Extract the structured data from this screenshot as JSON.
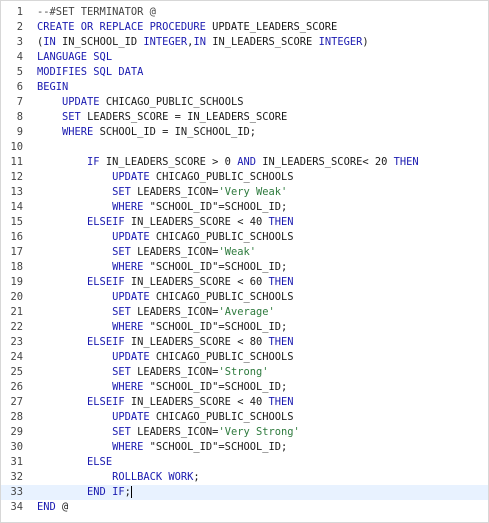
{
  "colors": {
    "keyword": "#1a1ab0",
    "string": "#2d7a3d",
    "text": "#1a1a1a",
    "line_number": "#444444",
    "active_line": "#e8f2ff"
  },
  "editor": {
    "active_line": 33,
    "lines": [
      {
        "num": "1",
        "tokens": [
          {
            "t": "comment",
            "v": "--#SET TERMINATOR @"
          }
        ]
      },
      {
        "num": "2",
        "tokens": [
          {
            "t": "keyword",
            "v": "CREATE OR REPLACE PROCEDURE"
          },
          {
            "t": "text",
            "v": " UPDATE_LEADERS_SCORE"
          }
        ]
      },
      {
        "num": "3",
        "tokens": [
          {
            "t": "punct",
            "v": "("
          },
          {
            "t": "keyword",
            "v": "IN"
          },
          {
            "t": "text",
            "v": " IN_SCHOOL_ID "
          },
          {
            "t": "type",
            "v": "INTEGER"
          },
          {
            "t": "punct",
            "v": ","
          },
          {
            "t": "keyword",
            "v": "IN"
          },
          {
            "t": "text",
            "v": " IN_LEADERS_SCORE "
          },
          {
            "t": "type",
            "v": "INTEGER"
          },
          {
            "t": "punct",
            "v": ")"
          }
        ]
      },
      {
        "num": "4",
        "tokens": [
          {
            "t": "keyword",
            "v": "LANGUAGE SQL"
          }
        ]
      },
      {
        "num": "5",
        "tokens": [
          {
            "t": "keyword",
            "v": "MODIFIES SQL DATA"
          }
        ]
      },
      {
        "num": "6",
        "tokens": [
          {
            "t": "keyword",
            "v": "BEGIN"
          }
        ]
      },
      {
        "num": "7",
        "tokens": [
          {
            "t": "text",
            "v": "    "
          },
          {
            "t": "keyword",
            "v": "UPDATE"
          },
          {
            "t": "text",
            "v": " CHICAGO_PUBLIC_SCHOOLS"
          }
        ]
      },
      {
        "num": "8",
        "tokens": [
          {
            "t": "text",
            "v": "    "
          },
          {
            "t": "keyword",
            "v": "SET"
          },
          {
            "t": "text",
            "v": " LEADERS_SCORE = IN_LEADERS_SCORE"
          }
        ]
      },
      {
        "num": "9",
        "tokens": [
          {
            "t": "text",
            "v": "    "
          },
          {
            "t": "keyword",
            "v": "WHERE"
          },
          {
            "t": "text",
            "v": " SCHOOL_ID = IN_SCHOOL_ID;"
          }
        ]
      },
      {
        "num": "10",
        "tokens": []
      },
      {
        "num": "11",
        "tokens": [
          {
            "t": "text",
            "v": "        "
          },
          {
            "t": "keyword",
            "v": "IF"
          },
          {
            "t": "text",
            "v": " IN_LEADERS_SCORE > 0 "
          },
          {
            "t": "keyword",
            "v": "AND"
          },
          {
            "t": "text",
            "v": " IN_LEADERS_SCORE< 20 "
          },
          {
            "t": "keyword",
            "v": "THEN"
          }
        ]
      },
      {
        "num": "12",
        "tokens": [
          {
            "t": "text",
            "v": "            "
          },
          {
            "t": "keyword",
            "v": "UPDATE"
          },
          {
            "t": "text",
            "v": " CHICAGO_PUBLIC_SCHOOLS"
          }
        ]
      },
      {
        "num": "13",
        "tokens": [
          {
            "t": "text",
            "v": "            "
          },
          {
            "t": "keyword",
            "v": "SET"
          },
          {
            "t": "text",
            "v": " LEADERS_ICON="
          },
          {
            "t": "string",
            "v": "'Very Weak'"
          }
        ]
      },
      {
        "num": "14",
        "tokens": [
          {
            "t": "text",
            "v": "            "
          },
          {
            "t": "keyword",
            "v": "WHERE"
          },
          {
            "t": "text",
            "v": " \"SCHOOL_ID\"=SCHOOL_ID;"
          }
        ]
      },
      {
        "num": "15",
        "tokens": [
          {
            "t": "text",
            "v": "        "
          },
          {
            "t": "keyword",
            "v": "ELSEIF"
          },
          {
            "t": "text",
            "v": " IN_LEADERS_SCORE < 40 "
          },
          {
            "t": "keyword",
            "v": "THEN"
          }
        ]
      },
      {
        "num": "16",
        "tokens": [
          {
            "t": "text",
            "v": "            "
          },
          {
            "t": "keyword",
            "v": "UPDATE"
          },
          {
            "t": "text",
            "v": " CHICAGO_PUBLIC_SCHOOLS"
          }
        ]
      },
      {
        "num": "17",
        "tokens": [
          {
            "t": "text",
            "v": "            "
          },
          {
            "t": "keyword",
            "v": "SET"
          },
          {
            "t": "text",
            "v": " LEADERS_ICON="
          },
          {
            "t": "string",
            "v": "'Weak'"
          }
        ]
      },
      {
        "num": "18",
        "tokens": [
          {
            "t": "text",
            "v": "            "
          },
          {
            "t": "keyword",
            "v": "WHERE"
          },
          {
            "t": "text",
            "v": " \"SCHOOL_ID\"=SCHOOL_ID;"
          }
        ]
      },
      {
        "num": "19",
        "tokens": [
          {
            "t": "text",
            "v": "        "
          },
          {
            "t": "keyword",
            "v": "ELSEIF"
          },
          {
            "t": "text",
            "v": " IN_LEADERS_SCORE < 60 "
          },
          {
            "t": "keyword",
            "v": "THEN"
          }
        ]
      },
      {
        "num": "20",
        "tokens": [
          {
            "t": "text",
            "v": "            "
          },
          {
            "t": "keyword",
            "v": "UPDATE"
          },
          {
            "t": "text",
            "v": " CHICAGO_PUBLIC_SCHOOLS"
          }
        ]
      },
      {
        "num": "21",
        "tokens": [
          {
            "t": "text",
            "v": "            "
          },
          {
            "t": "keyword",
            "v": "SET"
          },
          {
            "t": "text",
            "v": " LEADERS_ICON="
          },
          {
            "t": "string",
            "v": "'Average'"
          }
        ]
      },
      {
        "num": "22",
        "tokens": [
          {
            "t": "text",
            "v": "            "
          },
          {
            "t": "keyword",
            "v": "WHERE"
          },
          {
            "t": "text",
            "v": " \"SCHOOL_ID\"=SCHOOL_ID;"
          }
        ]
      },
      {
        "num": "23",
        "tokens": [
          {
            "t": "text",
            "v": "        "
          },
          {
            "t": "keyword",
            "v": "ELSEIF"
          },
          {
            "t": "text",
            "v": " IN_LEADERS_SCORE < 80 "
          },
          {
            "t": "keyword",
            "v": "THEN"
          }
        ]
      },
      {
        "num": "24",
        "tokens": [
          {
            "t": "text",
            "v": "            "
          },
          {
            "t": "keyword",
            "v": "UPDATE"
          },
          {
            "t": "text",
            "v": " CHICAGO_PUBLIC_SCHOOLS"
          }
        ]
      },
      {
        "num": "25",
        "tokens": [
          {
            "t": "text",
            "v": "            "
          },
          {
            "t": "keyword",
            "v": "SET"
          },
          {
            "t": "text",
            "v": " LEADERS_ICON="
          },
          {
            "t": "string",
            "v": "'Strong'"
          }
        ]
      },
      {
        "num": "26",
        "tokens": [
          {
            "t": "text",
            "v": "            "
          },
          {
            "t": "keyword",
            "v": "WHERE"
          },
          {
            "t": "text",
            "v": " \"SCHOOL_ID\"=SCHOOL_ID;"
          }
        ]
      },
      {
        "num": "27",
        "tokens": [
          {
            "t": "text",
            "v": "        "
          },
          {
            "t": "keyword",
            "v": "ELSEIF"
          },
          {
            "t": "text",
            "v": " IN_LEADERS_SCORE < 40 "
          },
          {
            "t": "keyword",
            "v": "THEN"
          }
        ]
      },
      {
        "num": "28",
        "tokens": [
          {
            "t": "text",
            "v": "            "
          },
          {
            "t": "keyword",
            "v": "UPDATE"
          },
          {
            "t": "text",
            "v": " CHICAGO_PUBLIC_SCHOOLS"
          }
        ]
      },
      {
        "num": "29",
        "tokens": [
          {
            "t": "text",
            "v": "            "
          },
          {
            "t": "keyword",
            "v": "SET"
          },
          {
            "t": "text",
            "v": " LEADERS_ICON="
          },
          {
            "t": "string",
            "v": "'Very Strong'"
          }
        ]
      },
      {
        "num": "30",
        "tokens": [
          {
            "t": "text",
            "v": "            "
          },
          {
            "t": "keyword",
            "v": "WHERE"
          },
          {
            "t": "text",
            "v": " \"SCHOOL_ID\"=SCHOOL_ID;"
          }
        ]
      },
      {
        "num": "31",
        "tokens": [
          {
            "t": "text",
            "v": "        "
          },
          {
            "t": "keyword",
            "v": "ELSE"
          }
        ]
      },
      {
        "num": "32",
        "tokens": [
          {
            "t": "text",
            "v": "            "
          },
          {
            "t": "keyword",
            "v": "ROLLBACK WORK"
          },
          {
            "t": "punct",
            "v": ";"
          }
        ]
      },
      {
        "num": "33",
        "tokens": [
          {
            "t": "text",
            "v": "        "
          },
          {
            "t": "keyword",
            "v": "END IF"
          },
          {
            "t": "punct",
            "v": ";"
          }
        ]
      },
      {
        "num": "34",
        "tokens": [
          {
            "t": "keyword",
            "v": "END"
          },
          {
            "t": "text",
            "v": " @"
          }
        ]
      }
    ]
  }
}
